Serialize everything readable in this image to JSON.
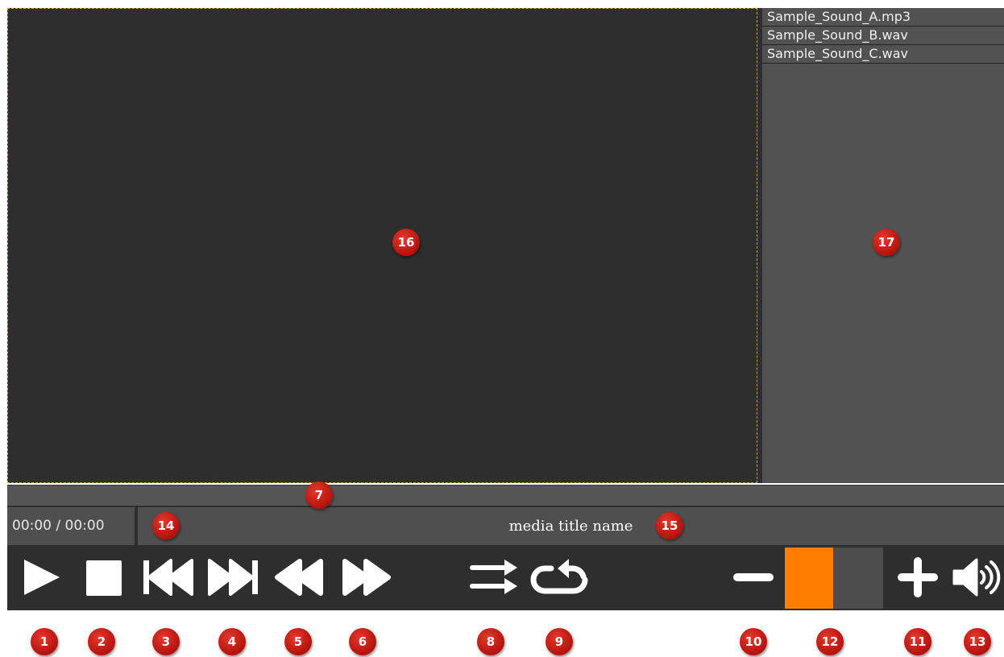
{
  "playlist": {
    "items": [
      "Sample_Sound_A.mp3",
      "Sample_Sound_B.wav",
      "Sample_Sound_C.wav"
    ]
  },
  "status": {
    "time": "00:00 / 00:00",
    "media_title": "media title name"
  },
  "volume": {
    "level": 0.49
  },
  "icons": {
    "play": "play-icon",
    "stop": "stop-icon",
    "previous": "skip-previous-icon",
    "next": "skip-next-icon",
    "rewind": "rewind-icon",
    "fast_forward": "fast-forward-icon",
    "shuffle": "shuffle-icon",
    "repeat": "repeat-icon",
    "volume_down": "minus-icon",
    "volume_up": "plus-icon",
    "mute": "speaker-icon"
  },
  "colors": {
    "accent": "#ff8000",
    "badge": "#c8170f",
    "panel": "#2e2e2e",
    "bar": "#4f4f4f"
  },
  "callouts": {
    "play": "1",
    "stop": "2",
    "previous": "3",
    "next": "4",
    "rewind": "5",
    "fast_forward": "6",
    "seek": "7",
    "shuffle": "8",
    "repeat": "9",
    "volume_down": "10",
    "volume_up": "11",
    "volume_bar": "12",
    "mute": "13",
    "time": "14",
    "title": "15",
    "video": "16",
    "playlist": "17"
  }
}
